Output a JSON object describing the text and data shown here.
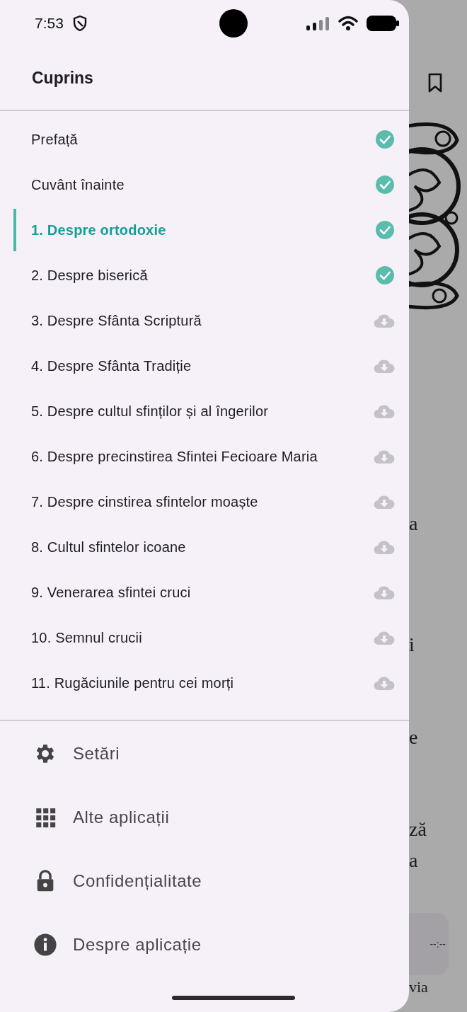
{
  "status_bar": {
    "time": "7:53"
  },
  "drawer": {
    "title": "Cuprins",
    "chapters": [
      {
        "label": "Prefață",
        "selected": false,
        "downloaded": true
      },
      {
        "label": "Cuvânt înainte",
        "selected": false,
        "downloaded": true
      },
      {
        "label": "1. Despre ortodoxie",
        "selected": true,
        "downloaded": true
      },
      {
        "label": "2. Despre biserică",
        "selected": false,
        "downloaded": true
      },
      {
        "label": "3. Despre Sfânta Scriptură",
        "selected": false,
        "downloaded": false
      },
      {
        "label": "4. Despre Sfânta Tradiție",
        "selected": false,
        "downloaded": false
      },
      {
        "label": "5. Despre cultul sfinților și al îngerilor",
        "selected": false,
        "downloaded": false
      },
      {
        "label": "6. Despre precinstirea Sfintei Fecioare Maria",
        "selected": false,
        "downloaded": false
      },
      {
        "label": "7. Despre cinstirea sfintelor moaște",
        "selected": false,
        "downloaded": false
      },
      {
        "label": "8. Cultul sfintelor icoane",
        "selected": false,
        "downloaded": false
      },
      {
        "label": "9. Venerarea sfintei cruci",
        "selected": false,
        "downloaded": false
      },
      {
        "label": "10. Semnul crucii",
        "selected": false,
        "downloaded": false
      },
      {
        "label": "11. Rugăciunile pentru cei morți",
        "selected": false,
        "downloaded": false
      }
    ],
    "menu": [
      {
        "kind": "settings",
        "label": "Setări"
      },
      {
        "kind": "apps",
        "label": "Alte aplicații"
      },
      {
        "kind": "privacy",
        "label": "Confidențialitate"
      },
      {
        "kind": "about",
        "label": "Despre aplicație"
      }
    ]
  },
  "background_page": {
    "text_fragments": [
      "a",
      "i",
      "e",
      "ză",
      "a",
      "via"
    ],
    "player_time": "--:--"
  }
}
